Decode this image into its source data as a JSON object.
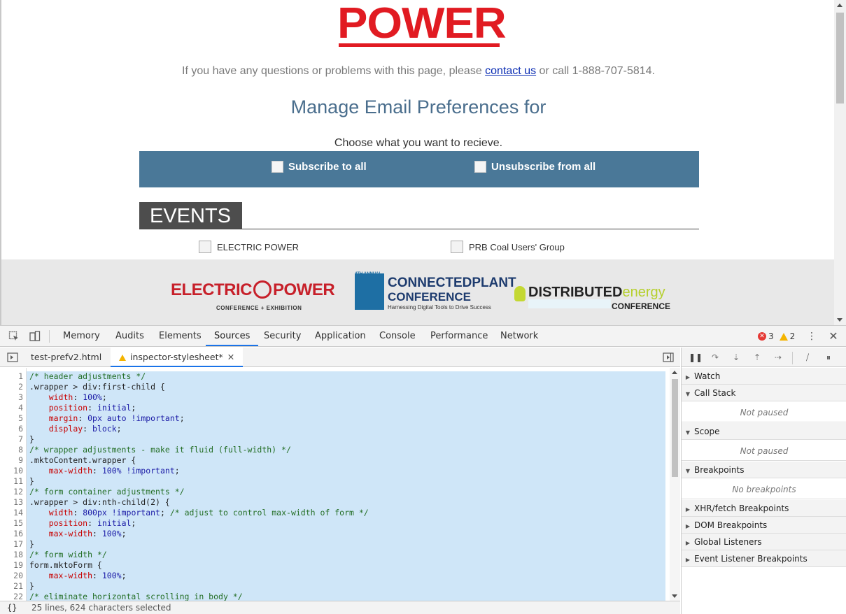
{
  "page": {
    "logo_text": "POWER",
    "contact": {
      "prefix": "If you have any questions or problems with this page, please ",
      "link": "contact us",
      "suffix": " or call 1-888-707-5814."
    },
    "title": "Manage Email Preferences for",
    "choose_text": "Choose what you want to recieve.",
    "subscribe_all": "Subscribe to all",
    "unsubscribe_all": "Unsubscribe from all",
    "events_heading": "EVENTS",
    "events": [
      {
        "label": "ELECTRIC POWER"
      },
      {
        "label": "PRB Coal Users' Group"
      }
    ],
    "sponsors": {
      "electric_power": {
        "main_a": "ELECTRIC",
        "main_b": "POWER",
        "sub": "CONFERENCE + EXHIBITION"
      },
      "connected_plant": {
        "badge": "4TH ANNUAL",
        "main": "CONNECTEDPLANT",
        "sub": "CONFERENCE",
        "tagline": "Harnessing Digital Tools to Drive Success"
      },
      "distributed_energy": {
        "main_a": "DISTRIBUTED",
        "main_b": "energy",
        "sub": "CONFERENCE"
      }
    },
    "colors": {
      "brand_red": "#e11b22",
      "title_blue": "#4a6e8d",
      "bar_blue": "#4a7898"
    }
  },
  "devtools": {
    "tabs": [
      "Memory",
      "Audits",
      "Elements",
      "Sources",
      "Security",
      "Application",
      "Console",
      "Performance",
      "Network"
    ],
    "active_tab": "Sources",
    "error_count": "3",
    "warning_count": "2",
    "file_tabs": [
      "test-prefv2.html",
      "inspector-stylesheet*"
    ],
    "code_lines": [
      [
        {
          "t": "comment",
          "v": "/* header adjustments */"
        }
      ],
      [
        {
          "t": "sel",
          "v": ".wrapper > div:first-child {"
        }
      ],
      [
        {
          "t": "plain",
          "v": "    "
        },
        {
          "t": "prop",
          "v": "width"
        },
        {
          "t": "plain",
          "v": ": "
        },
        {
          "t": "val",
          "v": "100%"
        },
        {
          "t": "plain",
          "v": ";"
        }
      ],
      [
        {
          "t": "plain",
          "v": "    "
        },
        {
          "t": "prop",
          "v": "position"
        },
        {
          "t": "plain",
          "v": ": "
        },
        {
          "t": "val",
          "v": "initial"
        },
        {
          "t": "plain",
          "v": ";"
        }
      ],
      [
        {
          "t": "plain",
          "v": "    "
        },
        {
          "t": "prop",
          "v": "margin"
        },
        {
          "t": "plain",
          "v": ": "
        },
        {
          "t": "val",
          "v": "0px"
        },
        {
          "t": "plain",
          "v": " "
        },
        {
          "t": "val",
          "v": "auto"
        },
        {
          "t": "plain",
          "v": " "
        },
        {
          "t": "val",
          "v": "!important"
        },
        {
          "t": "plain",
          "v": ";"
        }
      ],
      [
        {
          "t": "plain",
          "v": "    "
        },
        {
          "t": "prop",
          "v": "display"
        },
        {
          "t": "plain",
          "v": ": "
        },
        {
          "t": "val",
          "v": "block"
        },
        {
          "t": "plain",
          "v": ";"
        }
      ],
      [
        {
          "t": "sel",
          "v": "}"
        }
      ],
      [
        {
          "t": "comment",
          "v": "/* wrapper adjustments - make it fluid (full-width) */"
        }
      ],
      [
        {
          "t": "sel",
          "v": ".mktoContent.wrapper {"
        }
      ],
      [
        {
          "t": "plain",
          "v": "    "
        },
        {
          "t": "prop",
          "v": "max-width"
        },
        {
          "t": "plain",
          "v": ": "
        },
        {
          "t": "val",
          "v": "100%"
        },
        {
          "t": "plain",
          "v": " "
        },
        {
          "t": "val",
          "v": "!important"
        },
        {
          "t": "plain",
          "v": ";"
        }
      ],
      [
        {
          "t": "sel",
          "v": "}"
        }
      ],
      [
        {
          "t": "comment",
          "v": "/* form container adjustments */"
        }
      ],
      [
        {
          "t": "sel",
          "v": ".wrapper > div:nth-child(2) {"
        }
      ],
      [
        {
          "t": "plain",
          "v": "    "
        },
        {
          "t": "prop",
          "v": "width"
        },
        {
          "t": "plain",
          "v": ": "
        },
        {
          "t": "val",
          "v": "800px"
        },
        {
          "t": "plain",
          "v": " "
        },
        {
          "t": "val",
          "v": "!important"
        },
        {
          "t": "plain",
          "v": "; "
        },
        {
          "t": "comment",
          "v": "/* adjust to control max-width of form */"
        }
      ],
      [
        {
          "t": "plain",
          "v": "    "
        },
        {
          "t": "prop",
          "v": "position"
        },
        {
          "t": "plain",
          "v": ": "
        },
        {
          "t": "val",
          "v": "initial"
        },
        {
          "t": "plain",
          "v": ";"
        }
      ],
      [
        {
          "t": "plain",
          "v": "    "
        },
        {
          "t": "prop",
          "v": "max-width"
        },
        {
          "t": "plain",
          "v": ": "
        },
        {
          "t": "val",
          "v": "100%"
        },
        {
          "t": "plain",
          "v": ";"
        }
      ],
      [
        {
          "t": "sel",
          "v": "}"
        }
      ],
      [
        {
          "t": "comment",
          "v": "/* form width */"
        }
      ],
      [
        {
          "t": "sel",
          "v": "form.mktoForm {"
        }
      ],
      [
        {
          "t": "plain",
          "v": "    "
        },
        {
          "t": "prop",
          "v": "max-width"
        },
        {
          "t": "plain",
          "v": ": "
        },
        {
          "t": "val",
          "v": "100%"
        },
        {
          "t": "plain",
          "v": ";"
        }
      ],
      [
        {
          "t": "sel",
          "v": "}"
        }
      ],
      [
        {
          "t": "comment",
          "v": "/* eliminate horizontal scrolling in body */"
        }
      ]
    ],
    "status": "25 lines, 624 characters selected",
    "status_braces": "{}",
    "debugger": {
      "sections": [
        {
          "label": "Watch",
          "body": null
        },
        {
          "label": "Call Stack",
          "body": "Not paused"
        },
        {
          "label": "Scope",
          "body": "Not paused"
        },
        {
          "label": "Breakpoints",
          "body": "No breakpoints"
        },
        {
          "label": "XHR/fetch Breakpoints",
          "body": null
        },
        {
          "label": "DOM Breakpoints",
          "body": null
        },
        {
          "label": "Global Listeners",
          "body": null
        },
        {
          "label": "Event Listener Breakpoints",
          "body": null
        }
      ]
    }
  }
}
